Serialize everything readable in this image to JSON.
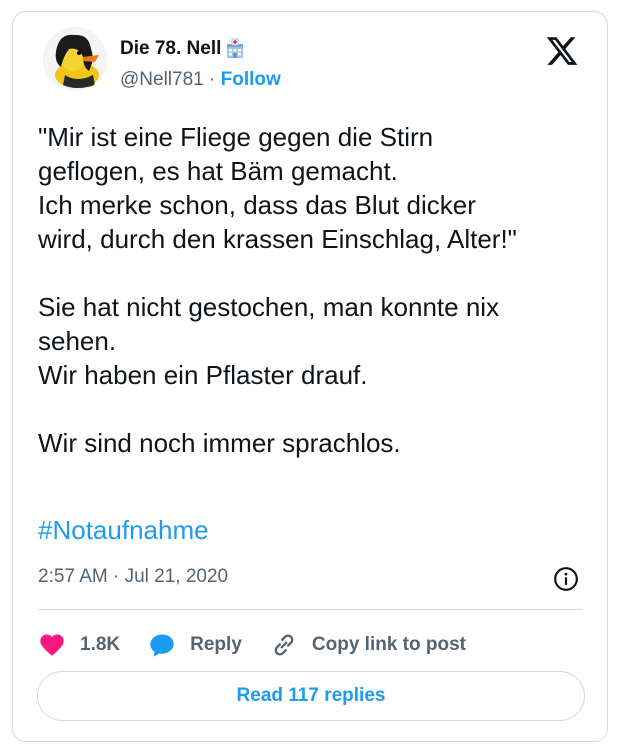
{
  "author": {
    "name": "Die 78. Nell",
    "name_emoji": "hospital-icon",
    "handle": "@Nell781",
    "separator": "·",
    "follow_label": "Follow"
  },
  "platform_icon": "x-logo-icon",
  "tweet": {
    "text": "\"Mir ist eine Fliege gegen die Stirn\ngeflogen, es hat Bäm gemacht.\nIch merke schon, dass das Blut dicker\nwird, durch den krassen Einschlag, Alter!\"\n\nSie hat nicht gestochen, man konnte nix\nsehen.\nWir haben ein Pflaster drauf.\n\nWir sind noch immer sprachlos.",
    "hashtag": "#Notaufnahme",
    "timestamp": "2:57 AM · Jul 21, 2020"
  },
  "actions": {
    "like_count": "1.8K",
    "reply_label": "Reply",
    "copy_label": "Copy link to post"
  },
  "read_replies_label": "Read 117 replies",
  "colors": {
    "accent": "#1d9bf0",
    "heart": "#f91880",
    "text": "#0f1419",
    "muted": "#536471",
    "border": "#cfd9de"
  }
}
